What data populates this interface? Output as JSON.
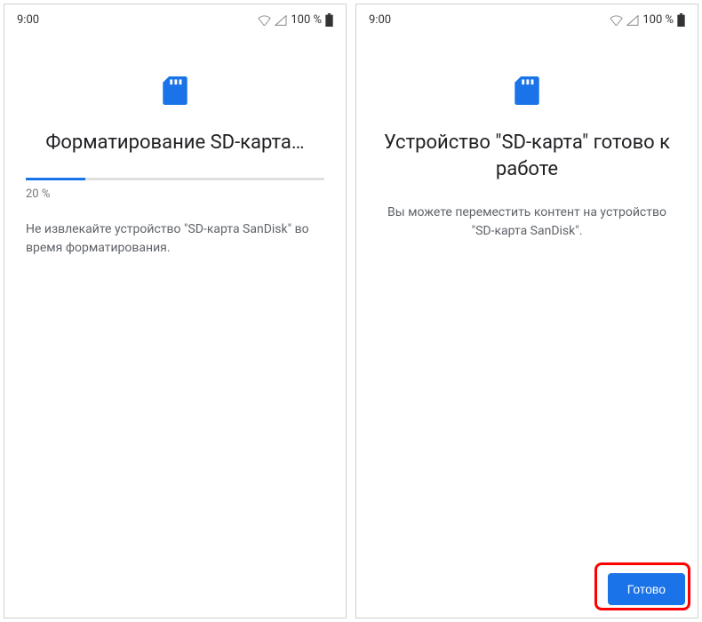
{
  "status": {
    "time": "9:00",
    "battery_percent": "100 %"
  },
  "left": {
    "title": "Форматирование SD-карта…",
    "progress_percent": 20,
    "progress_label": "20 %",
    "description": "Не извлекайте устройство \"SD-карта SanDisk\" во время форматирования."
  },
  "right": {
    "title": "Устройство \"SD-карта\" готово к работе",
    "description": "Вы можете переместить контент на устройство \"SD-карта SanDisk\".",
    "done_button_label": "Готово"
  },
  "icons": {
    "sd_card": "sd-card-icon",
    "wifi": "wifi-icon",
    "cell": "cell-icon",
    "battery": "battery-icon"
  },
  "colors": {
    "accent": "#1a73e8",
    "highlight": "#ff0000"
  }
}
